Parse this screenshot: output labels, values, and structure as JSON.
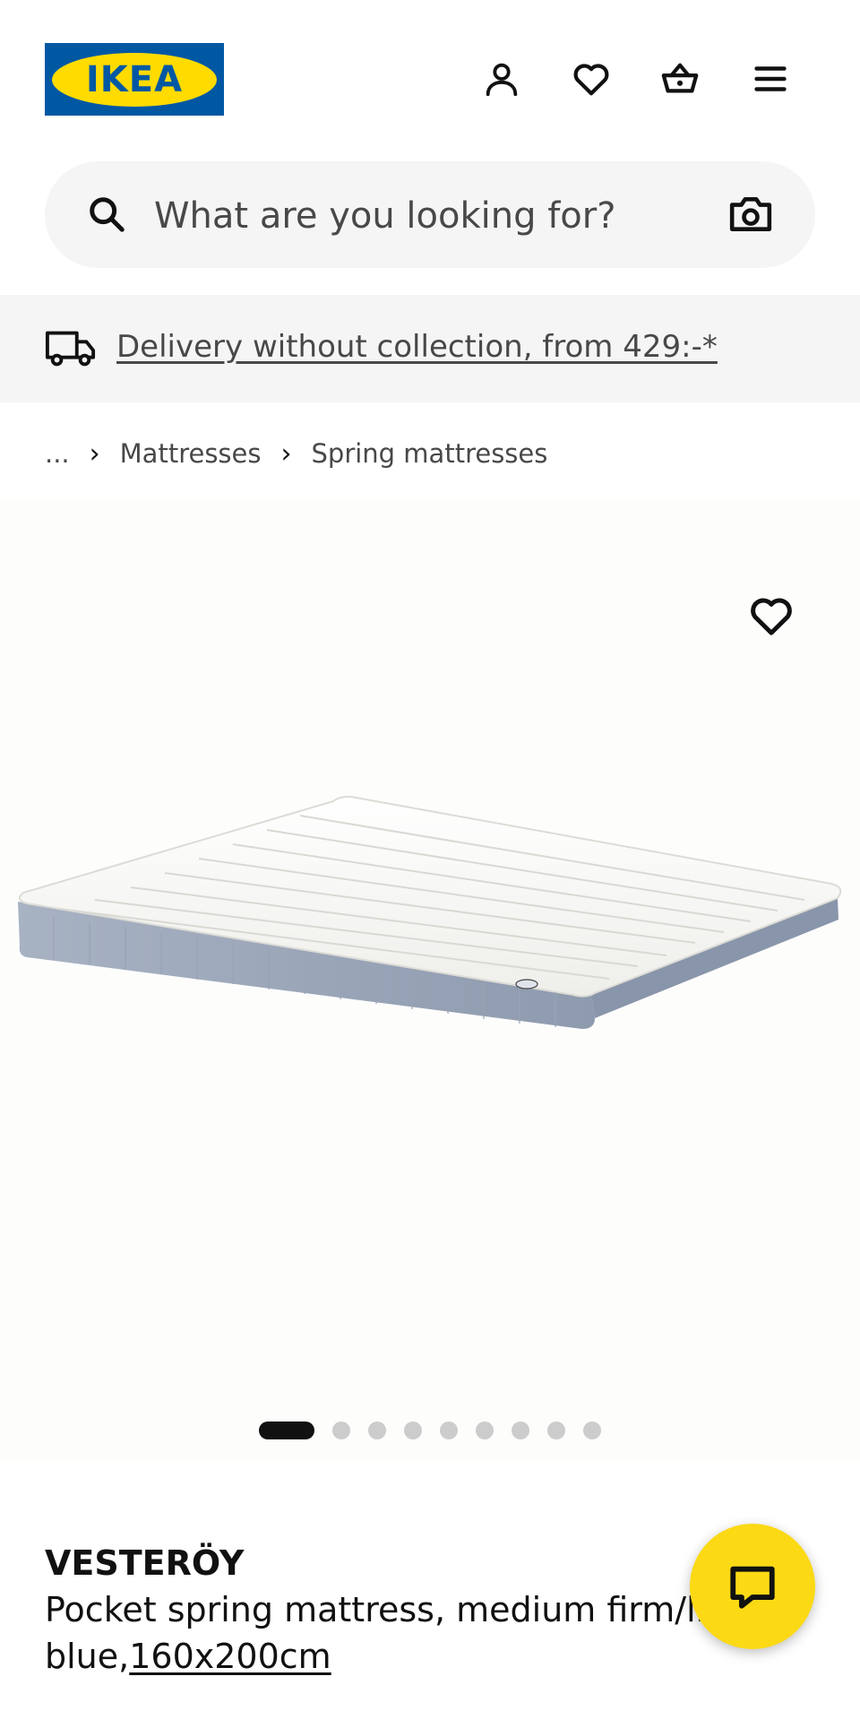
{
  "header": {
    "logo_text": "IKEA",
    "icons": [
      "profile-icon",
      "heart-icon",
      "basket-icon",
      "menu-icon"
    ]
  },
  "search": {
    "placeholder": "What are you looking for?"
  },
  "delivery": {
    "text": "Delivery without collection, from 429:-*"
  },
  "breadcrumb": {
    "ellipsis": "...",
    "items": [
      "Mattresses",
      "Spring mattresses"
    ]
  },
  "gallery": {
    "dot_count": 9,
    "active_index": 0
  },
  "product": {
    "name": "VESTERÖY",
    "description": "Pocket spring mattress, medium firm/light blue,",
    "size": "160x200cm"
  },
  "colors": {
    "ikea_blue": "#0058a3",
    "ikea_yellow": "#ffdb00",
    "chat_yellow": "#fbd914"
  }
}
